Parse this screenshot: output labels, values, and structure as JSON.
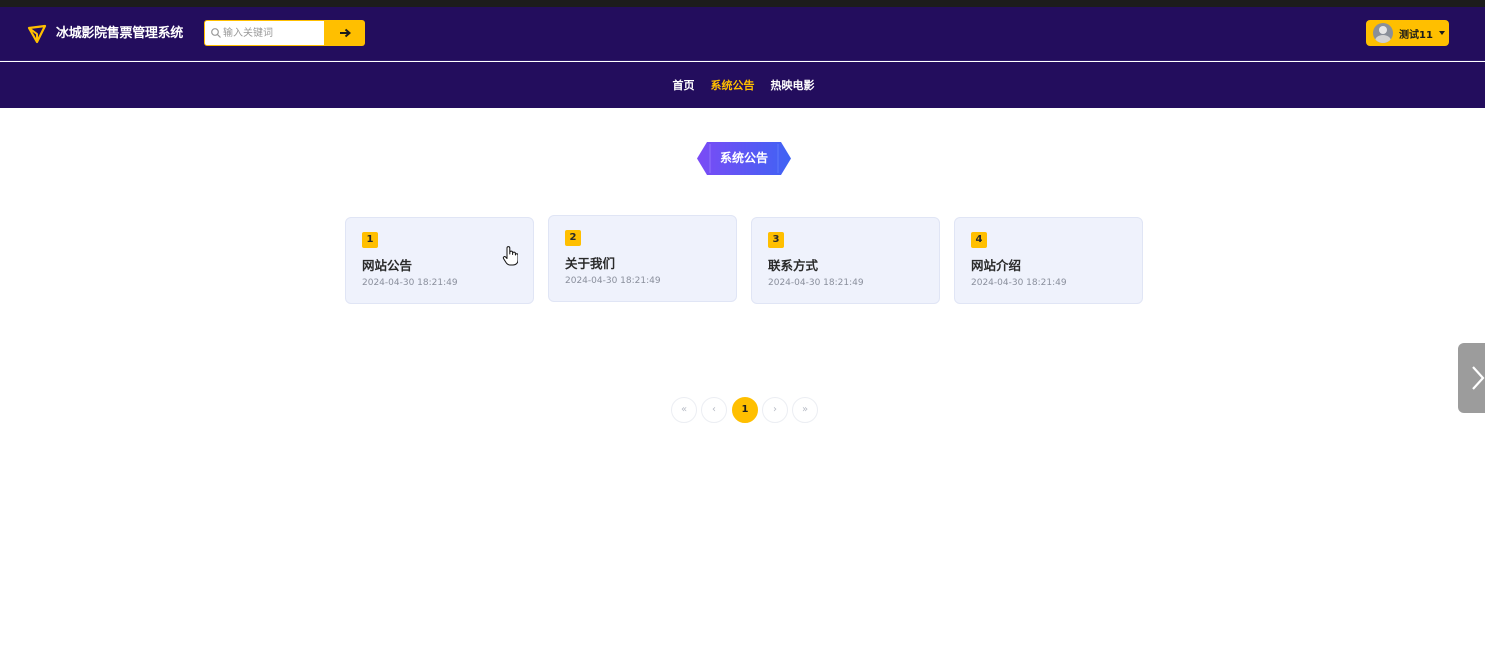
{
  "header": {
    "brand": "冰城影院售票管理系统",
    "search": {
      "placeholder": "输入关键词",
      "value": ""
    },
    "user": {
      "name": "测试11"
    }
  },
  "nav": {
    "items": [
      {
        "label": "首页",
        "active": false
      },
      {
        "label": "系统公告",
        "active": true
      },
      {
        "label": "热映电影",
        "active": false
      }
    ]
  },
  "section": {
    "title": "系统公告"
  },
  "notices": [
    {
      "index": "1",
      "title": "网站公告",
      "date": "2024-04-30 18:21:49"
    },
    {
      "index": "2",
      "title": "关于我们",
      "date": "2024-04-30 18:21:49"
    },
    {
      "index": "3",
      "title": "联系方式",
      "date": "2024-04-30 18:21:49"
    },
    {
      "index": "4",
      "title": "网站介绍",
      "date": "2024-04-30 18:21:49"
    }
  ],
  "pagination": {
    "first": "«",
    "prev": "‹",
    "current": "1",
    "next": "›",
    "last": "»"
  },
  "colors": {
    "header_bg": "#230d5d",
    "accent": "#ffbf00",
    "card_bg": "#eff2fc"
  },
  "icons": {
    "logo": "paper-plane-icon",
    "search": "search-icon",
    "submit": "arrow-right-icon",
    "caret": "caret-down-icon",
    "side": "chevron-right-icon"
  }
}
